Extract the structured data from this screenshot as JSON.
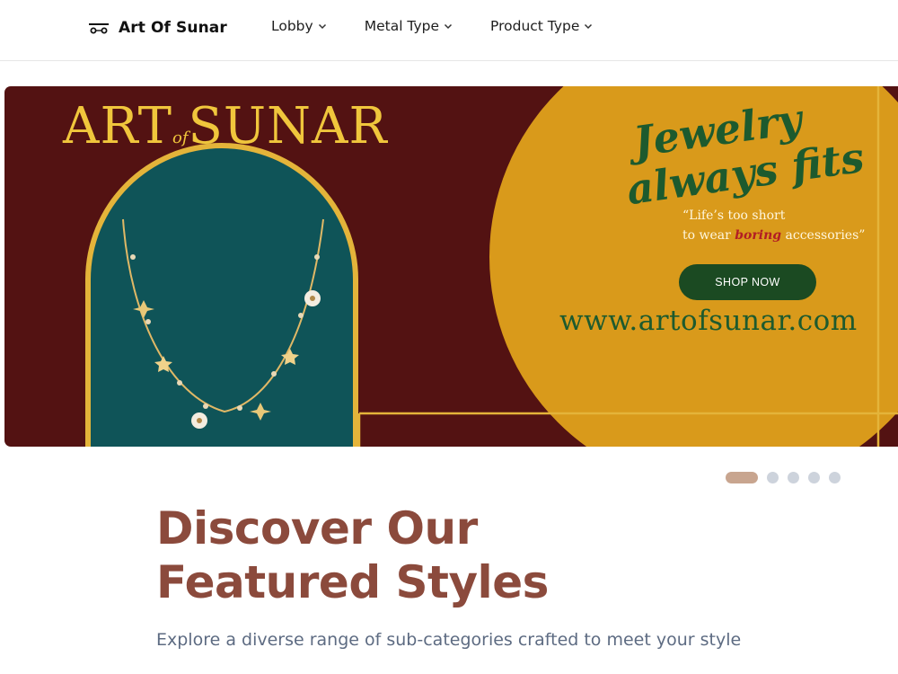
{
  "header": {
    "brand_name": "Art Of Sunar",
    "brand_icon": "jewelry-cart-icon",
    "nav": [
      {
        "label": "Lobby",
        "icon": "chevron-down-icon"
      },
      {
        "label": "Metal Type",
        "icon": "chevron-down-icon"
      },
      {
        "label": "Product Type",
        "icon": "chevron-down-icon"
      }
    ]
  },
  "hero": {
    "logo_text_left": "ART",
    "logo_text_of": "of",
    "logo_text_right": "SUNAR",
    "tagline_line1": "Jewelry",
    "tagline_line2": "always fits",
    "quote_line1": "“Life’s too short",
    "quote_line2_start": "to wear",
    "quote_line2_highlight": "boring",
    "quote_line2_end": "accessories”",
    "shop_button": "SHOP NOW",
    "url": "www.artofsunar.com",
    "colors": {
      "background": "#531212",
      "circle": "#d99a1b",
      "arch": "#0f5458",
      "gold": "#e4b43a",
      "green": "#1d5a2e"
    }
  },
  "carousel": {
    "slide_count": 5,
    "active_index": 0
  },
  "featured": {
    "title_line1": "Discover Our",
    "title_line2": "Featured Styles",
    "subtitle": "Explore a diverse range of sub-categories crafted to meet your style"
  }
}
